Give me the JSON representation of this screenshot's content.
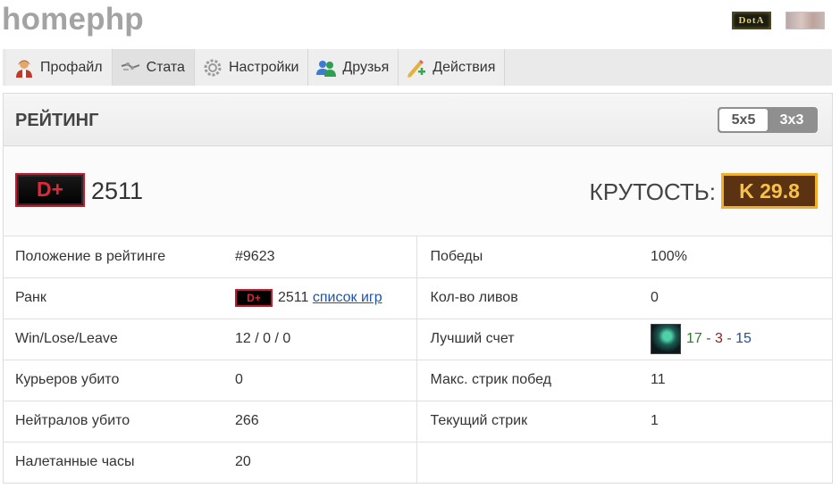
{
  "site": {
    "title": "homephp",
    "badge_dota": "DotA"
  },
  "tabs": [
    {
      "label": "Профайл",
      "icon": "user-icon",
      "active": false
    },
    {
      "label": "Стата",
      "icon": "stats-icon",
      "active": true
    },
    {
      "label": "Настройки",
      "icon": "gear-icon",
      "active": false
    },
    {
      "label": "Друзья",
      "icon": "friends-icon",
      "active": false
    },
    {
      "label": "Действия",
      "icon": "pencil-icon",
      "active": false
    }
  ],
  "panel": {
    "title": "РЕЙТИНГ",
    "modes": {
      "a": "5x5",
      "b": "3x3",
      "selected": "5x5"
    }
  },
  "summary": {
    "rank_badge": "D+",
    "rank_value": "2511",
    "cool_label": "КРУТОСТЬ:",
    "cool_value": "K 29.8"
  },
  "stats": {
    "left": [
      {
        "key": "Положение в рейтинге",
        "value": "#9623"
      },
      {
        "key": "Ранк",
        "value_badge": "D+",
        "value": "2511",
        "link": "список игр"
      },
      {
        "key": "Win/Lose/Leave",
        "value": "12 / 0 / 0"
      },
      {
        "key": "Курьеров убито",
        "value": "0"
      },
      {
        "key": "Нейтралов убито",
        "value": "266"
      },
      {
        "key": "Налетанные часы",
        "value": "20"
      }
    ],
    "right": [
      {
        "key": "Победы",
        "value": "100%"
      },
      {
        "key": "Кол-во ливов",
        "value": "0"
      },
      {
        "key": "Лучший счет",
        "kills": "17",
        "sep1": " - ",
        "deaths": "3",
        "sep2": " - ",
        "assists": "15"
      },
      {
        "key": "Макс. стрик побед",
        "value": "11"
      },
      {
        "key": "Текущий стрик",
        "value": "1"
      }
    ]
  },
  "colors": {
    "accent_link": "#1f55a8",
    "rank_red": "#e22835",
    "cool_gold": "#f0b02b"
  }
}
